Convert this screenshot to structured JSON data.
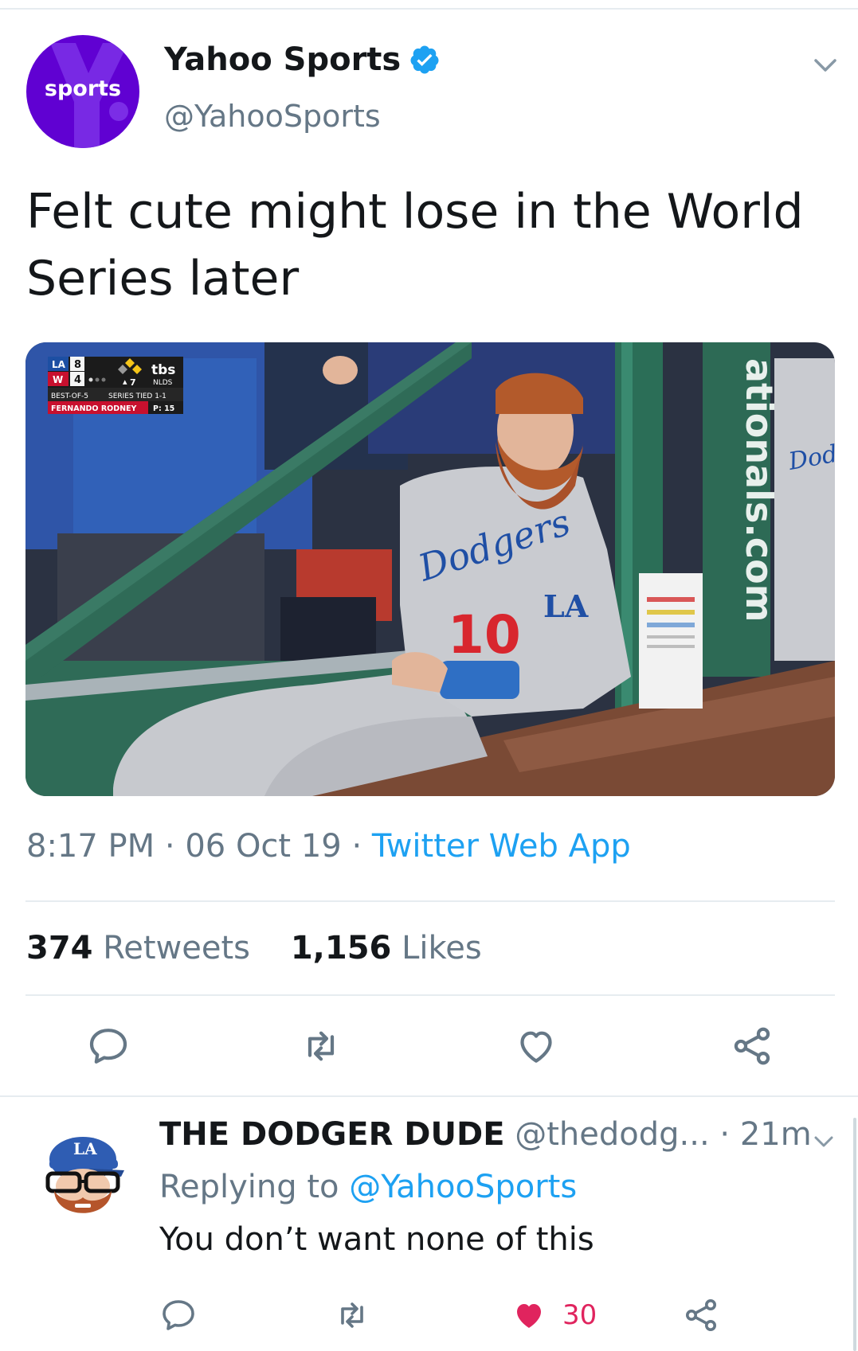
{
  "tweet": {
    "avatar_label": "sports",
    "display_name": "Yahoo Sports",
    "handle": "@YahooSports",
    "text": "Felt cute might lose in the World Series later",
    "media": {
      "scorebug": {
        "team1": "LA",
        "score1": "8",
        "team2": "W",
        "score2": "4",
        "inning": "7",
        "network": "tbs",
        "round": "NLDS",
        "series_format": "BEST-OF-5",
        "series_status": "SERIES TIED 1-1",
        "pitcher": "FERNANDO RODNEY",
        "pitch_count": "P: 15"
      },
      "jersey_script": "Dodgers",
      "jersey_number": "10",
      "sleeve_logo": "LA",
      "wall_text": "ationals.com",
      "other_jersey": "Dodgers"
    },
    "time": "8:17 PM",
    "date": "06 Oct 19",
    "dot": "·",
    "source": "Twitter Web App",
    "retweets_count": "374",
    "retweets_label": "Retweets",
    "likes_count": "1,156",
    "likes_label": "Likes"
  },
  "reply": {
    "display_name": "THE DODGER DUDE",
    "handle": "@thedodg...",
    "time": "· 21m",
    "replying_prefix": "Replying to",
    "replying_to": "@YahooSports",
    "text": "You don’t want none of this",
    "like_count": "30"
  },
  "colors": {
    "accent": "#1da1f2",
    "like": "#e0245e",
    "yahoo_purple": "#6001d2",
    "muted": "#657786"
  }
}
